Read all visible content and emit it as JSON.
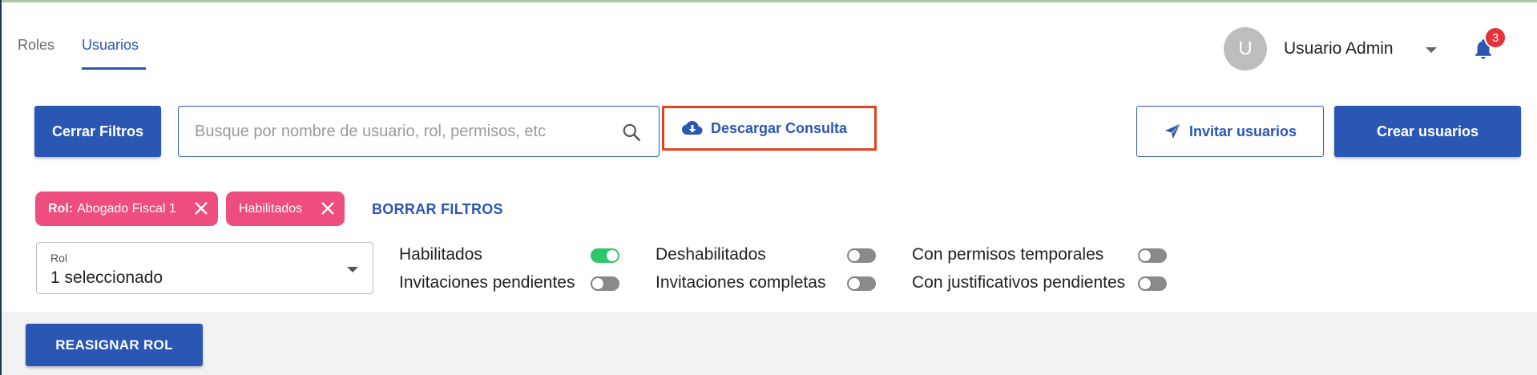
{
  "tabs": [
    {
      "label": "Roles",
      "active": false
    },
    {
      "label": "Usuarios",
      "active": true
    }
  ],
  "user": {
    "avatar_letter": "U",
    "name": "Usuario Admin"
  },
  "notifications": {
    "count": "3"
  },
  "toolbar": {
    "close_filters_label": "Cerrar Filtros",
    "search_placeholder": "Busque por nombre de usuario, rol, permisos, etc",
    "download_label": "Descargar Consulta",
    "invite_label": "Invitar usuarios",
    "create_label": "Crear usuarios"
  },
  "chips": [
    {
      "prefix": "Rol:",
      "text": "Abogado Fiscal 1"
    },
    {
      "prefix": "",
      "text": "Habilitados"
    }
  ],
  "clear_filters_label": "BORRAR FILTROS",
  "role_select": {
    "label": "Rol",
    "value": "1 seleccionado"
  },
  "toggles": {
    "habilitados": {
      "label": "Habilitados",
      "on": true
    },
    "invitaciones_pendientes": {
      "label": "Invitaciones pendientes",
      "on": false
    },
    "deshabilitados": {
      "label": "Deshabilitados",
      "on": false
    },
    "invitaciones_completas": {
      "label": "Invitaciones completas",
      "on": false
    },
    "permisos_temporales": {
      "label": "Con permisos temporales",
      "on": false
    },
    "justificativos_pendientes": {
      "label": "Con justificativos pendientes",
      "on": false
    }
  },
  "reassign_label": "REASIGNAR ROL",
  "colors": {
    "primary": "#2a56b4",
    "chip": "#ee4d80",
    "toggle_on": "#2fc76a",
    "highlight": "#e4411f",
    "badge": "#e8323a"
  },
  "icons": [
    "search-icon",
    "cloud-download-icon",
    "send-icon",
    "bell-icon",
    "close-icon",
    "chevron-down-icon"
  ]
}
